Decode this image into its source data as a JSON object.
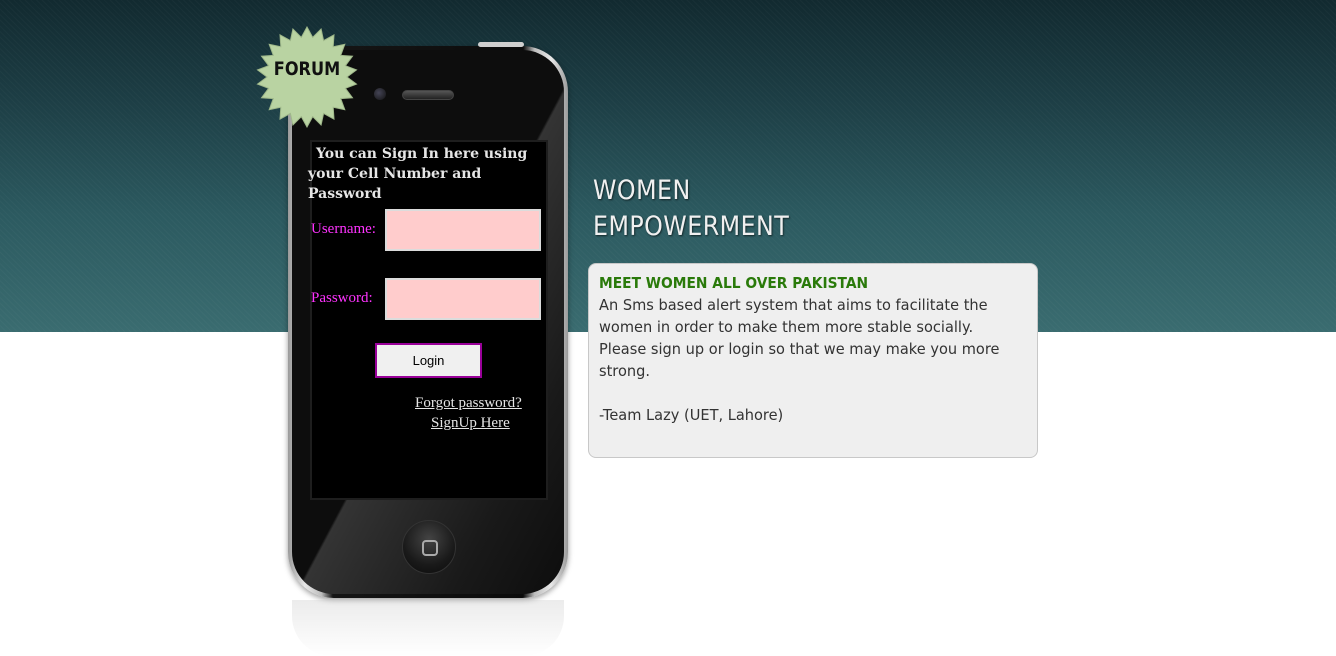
{
  "badge": {
    "label": "FORUM",
    "color": "#b9d3a2"
  },
  "login": {
    "intro": "You can Sign In here using your Cell Number and Password",
    "username_label": "Username:",
    "username_value": "",
    "password_label": "Password:",
    "password_value": "",
    "login_button": "Login",
    "forgot_link": "Forgot password?",
    "signup_link": "SignUp Here",
    "field_color": "#ffcccc",
    "label_color": "#ff33ff"
  },
  "headline": {
    "line1": "WOMEN",
    "line2": "EMPOWERMENT"
  },
  "info": {
    "title": "MEET WOMEN ALL OVER PAKISTAN",
    "body": "An Sms based alert system that aims to facilitate the women in order to make them more stable socially. Please sign up or login so that we may make you more strong.",
    "signature": "-Team Lazy (UET, Lahore)",
    "title_color": "#2a7a0a"
  }
}
